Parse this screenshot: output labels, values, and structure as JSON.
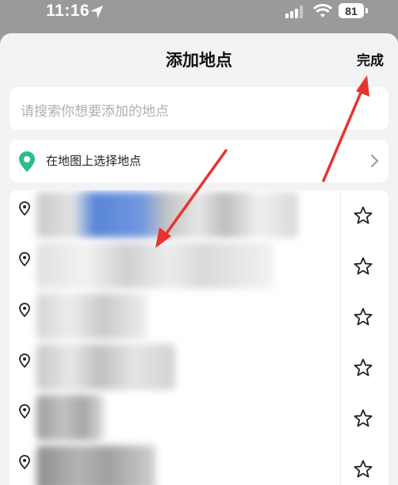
{
  "status_bar": {
    "time": "11:16",
    "battery": "81"
  },
  "sheet": {
    "title": "添加地点",
    "done_label": "完成",
    "search_placeholder": "请搜索你想要添加的地点",
    "map_pick_label": "在地图上选择地点"
  },
  "colors": {
    "accent_green": "#2bbd8a",
    "annotation_red": "#e8332f"
  },
  "icons": {
    "location_arrow": "location-arrow-icon",
    "signal": "signal-icon",
    "wifi": "wifi-icon",
    "battery": "battery-icon",
    "map_pin": "map-pin-icon",
    "chevron": "chevron-right-icon",
    "row_pin": "location-pin-icon",
    "star": "star-outline-icon"
  }
}
